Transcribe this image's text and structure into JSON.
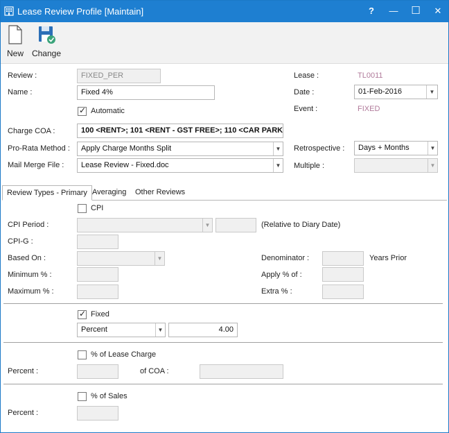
{
  "window": {
    "title": "Lease Review Profile [Maintain]",
    "help_glyph": "?",
    "minimize_glyph": "—",
    "maximize_glyph": "☐",
    "close_glyph": "✕"
  },
  "toolbar": {
    "new_label": "New",
    "change_label": "Change"
  },
  "header": {
    "review_label": "Review :",
    "review_value": "FIXED_PER",
    "name_label": "Name :",
    "name_value": "Fixed 4%",
    "automatic_label": "Automatic",
    "automatic_checked": true,
    "lease_label": "Lease :",
    "lease_value": "TL0011",
    "date_label": "Date :",
    "date_value": "01-Feb-2016",
    "event_label": "Event :",
    "event_value": "FIXED",
    "charge_coa_label": "Charge COA :",
    "charge_coa_value": "100 <RENT>; 101 <RENT - GST FREE>; 110 <CAR PARKI",
    "pro_rata_label": "Pro-Rata Method :",
    "pro_rata_value": "Apply Charge Months Split",
    "mail_merge_label": "Mail Merge File :",
    "mail_merge_value": "Lease Review - Fixed.doc",
    "retrospective_label": "Retrospective :",
    "retrospective_value": "Days + Months",
    "multiple_label": "Multiple :",
    "multiple_value": ""
  },
  "tabs": [
    {
      "label": "Review Types - Primary",
      "active": true
    },
    {
      "label": "Averaging",
      "active": false
    },
    {
      "label": "Other Reviews",
      "active": false
    }
  ],
  "cpi": {
    "label": "CPI",
    "checked": false,
    "period_label": "CPI Period :",
    "period_value": "",
    "period_offset_value": "",
    "relative_note": "(Relative to Diary Date)",
    "cpig_label": "CPI-G :",
    "cpig_value": "",
    "based_on_label": "Based On :",
    "based_on_value": "",
    "minimum_label": "Minimum % :",
    "minimum_value": "",
    "maximum_label": "Maximum % :",
    "maximum_value": "",
    "denominator_label": "Denominator :",
    "denominator_value": "",
    "years_prior_label": "Years Prior",
    "apply_label": "Apply % of :",
    "apply_value": "",
    "extra_label": "Extra % :",
    "extra_value": ""
  },
  "fixed": {
    "label": "Fixed",
    "checked": true,
    "type_value": "Percent",
    "amount_value": "4.00"
  },
  "lease_charge": {
    "label": "% of Lease Charge",
    "checked": false,
    "percent_label": "Percent :",
    "percent_value": "",
    "of_coa_label": "of COA :",
    "of_coa_value": ""
  },
  "sales": {
    "label": "% of Sales",
    "checked": false,
    "percent_label": "Percent :",
    "percent_value": ""
  },
  "colors": {
    "titlebar": "#1e7fd1",
    "readonly_value": "#b07a9a"
  }
}
